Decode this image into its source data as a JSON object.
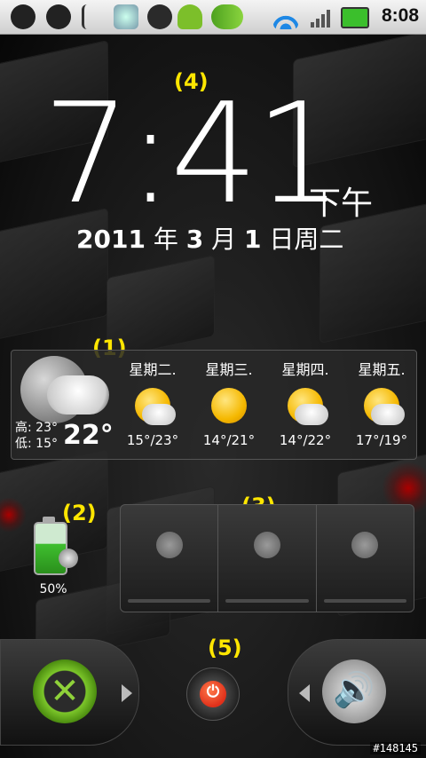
{
  "status_bar": {
    "time": "8:08",
    "icons": [
      "chat-icon",
      "lock-icon",
      "usb-icon",
      "settings-icon",
      "skype-icon",
      "android-icon",
      "pea-icon",
      "wifi-icon",
      "signal-icon",
      "battery-charging-icon"
    ]
  },
  "markers": {
    "weather": "(1)",
    "battery": "(2)",
    "power_control": "(3)",
    "clock": "(4)",
    "power": "(5)"
  },
  "clock": {
    "time": "7:41",
    "ampm": "下午",
    "date_year": "2011",
    "date_year_suffix": " 年 ",
    "date_month": "3",
    "date_month_suffix": " 月 ",
    "date_day": "1",
    "date_day_suffix": " 日周二"
  },
  "weather": {
    "high_label": "高: 23°",
    "low_label": "低: 15°",
    "current_temp": "22°",
    "forecast": [
      {
        "day": "星期二.",
        "temp": "15°/23°",
        "icon": "partly-cloudy-icon"
      },
      {
        "day": "星期三.",
        "temp": "14°/21°",
        "icon": "sunny-icon"
      },
      {
        "day": "星期四.",
        "temp": "14°/22°",
        "icon": "partly-cloudy-icon"
      },
      {
        "day": "星期五.",
        "temp": "17°/19°",
        "icon": "partly-cloudy-icon"
      }
    ]
  },
  "battery_widget": {
    "percent": "50%",
    "level": 0.5
  },
  "power_control": {
    "buttons": [
      "power-saver-icon",
      "brightness-icon",
      "auto-brightness-icon"
    ]
  },
  "watermark": "#148145"
}
